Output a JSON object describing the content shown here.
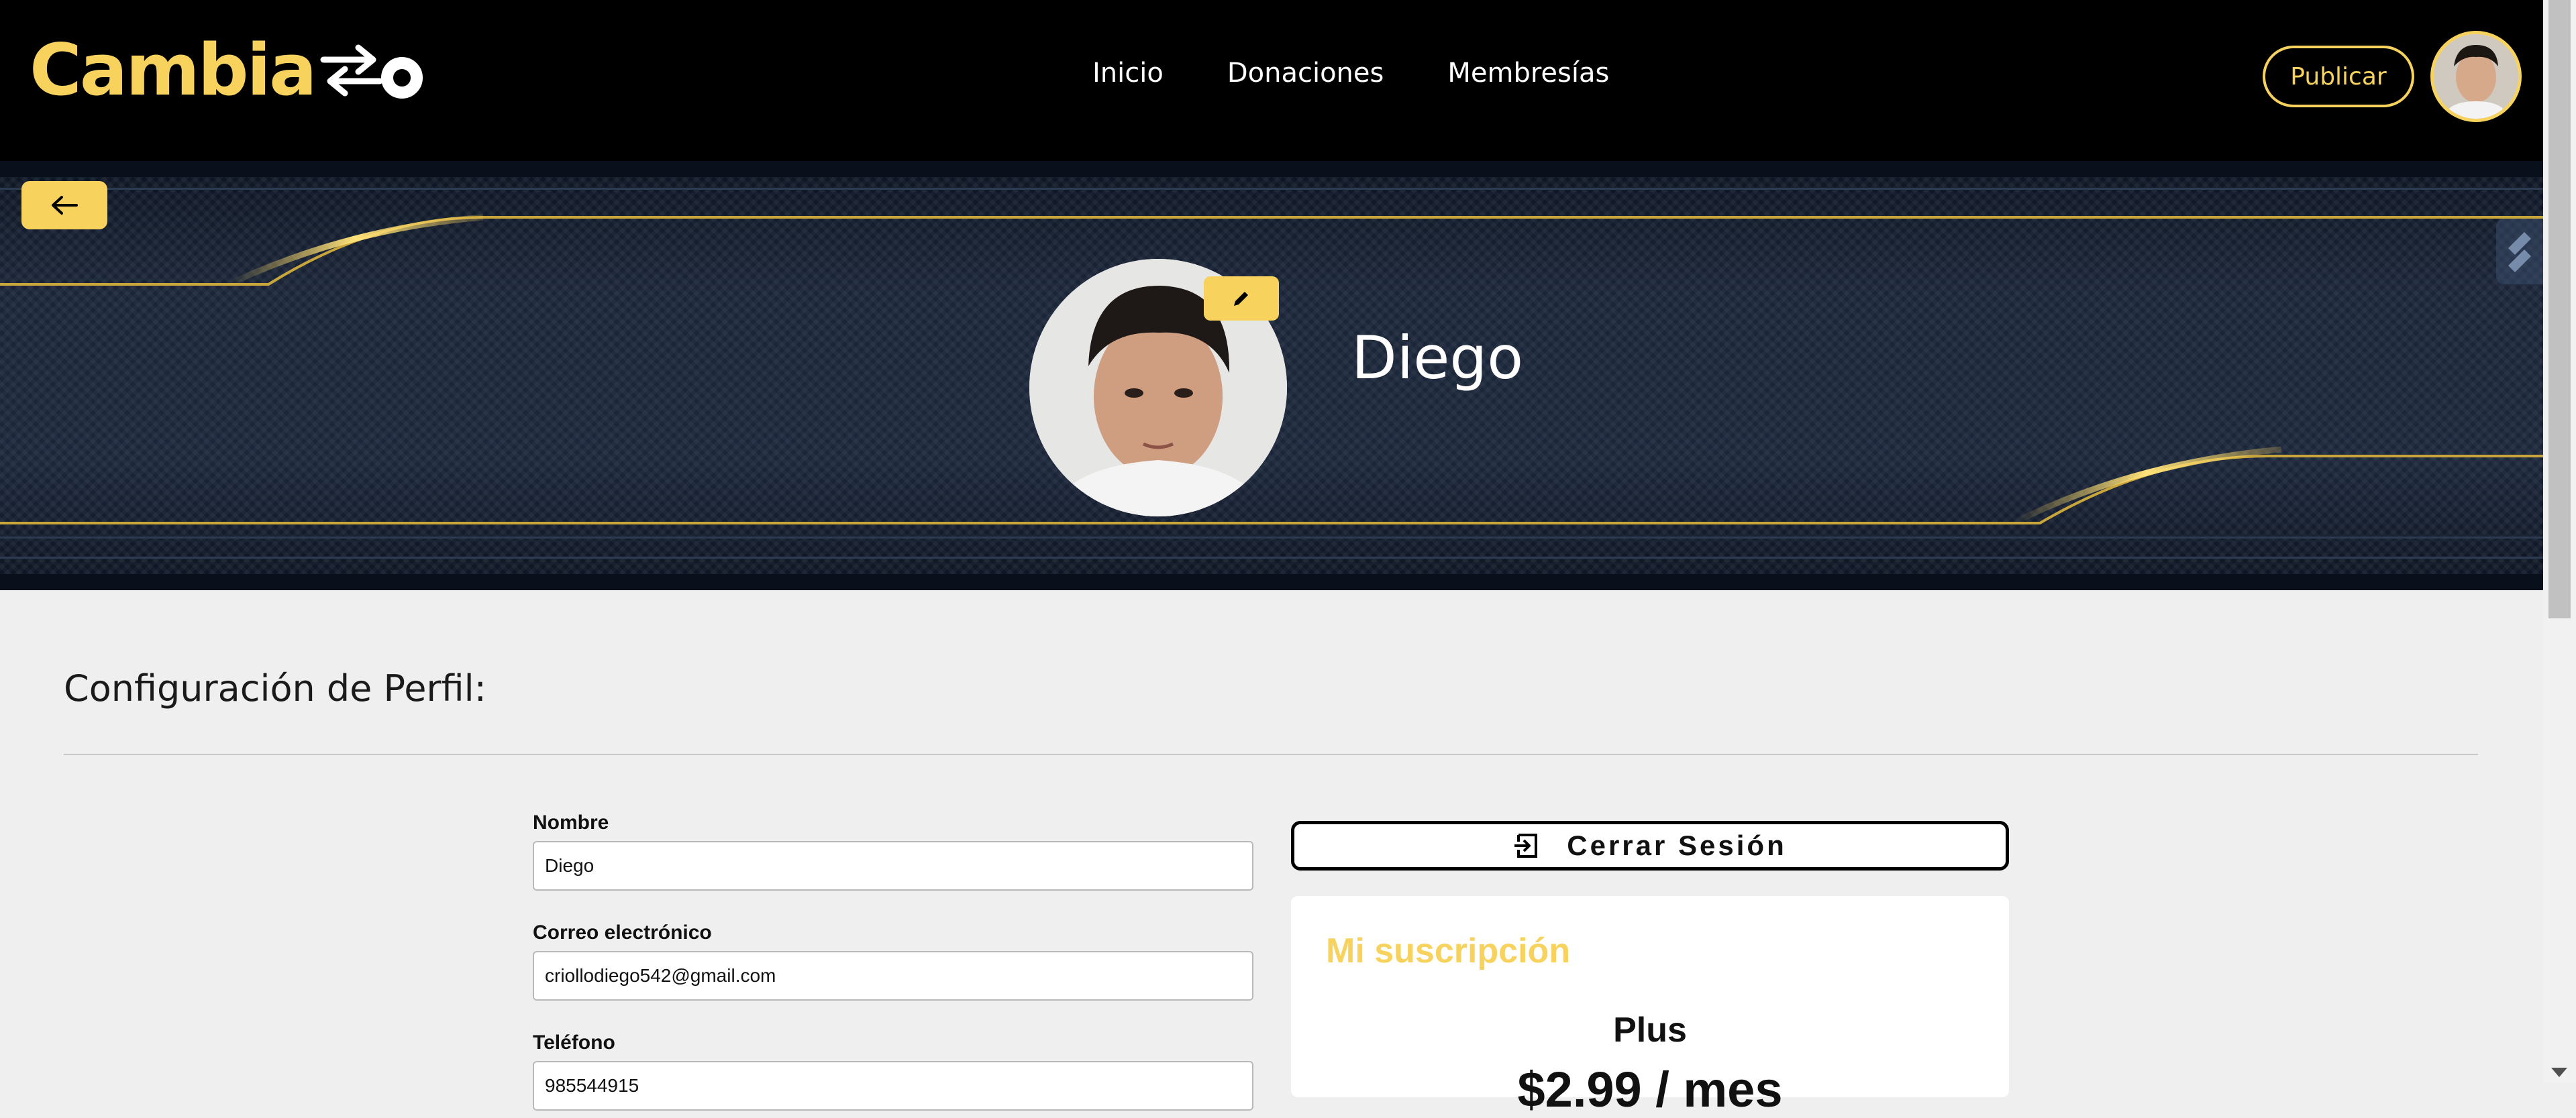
{
  "brand": {
    "name_prefix": "Cambia",
    "accent_color": "#f7d25d"
  },
  "nav": {
    "links": [
      "Inicio",
      "Donaciones",
      "Membresías"
    ],
    "publish_label": "Publicar"
  },
  "profile": {
    "name": "Diego"
  },
  "settings": {
    "title": "Configuración de Perfil:",
    "fields": [
      {
        "label": "Nombre",
        "value": "Diego"
      },
      {
        "label": "Correo electrónico",
        "value": "criollodiego542@gmail.com"
      },
      {
        "label": "Teléfono",
        "value": "985544915"
      }
    ],
    "logout_label": "Cerrar Sesión"
  },
  "subscription": {
    "title": "Mi suscripción",
    "plan": "Plus",
    "price": "$2.99 / mes"
  },
  "icons": {
    "back": "arrow-left-icon",
    "edit": "pencil-icon",
    "logout": "logout-icon"
  }
}
